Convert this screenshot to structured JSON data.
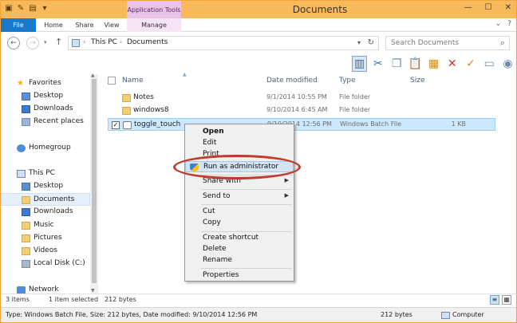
{
  "window": {
    "title": "Documents",
    "context_tab_group": "Application Tools",
    "controls": {
      "minimize": "—",
      "maximize": "☐",
      "close": "✕"
    }
  },
  "ribbon": {
    "tabs": {
      "file": "File",
      "home": "Home",
      "share": "Share",
      "view": "View",
      "manage": "Manage"
    },
    "expand_glyph": "⌄",
    "help_glyph": "?"
  },
  "address": {
    "crumbs": [
      "This PC",
      "Documents"
    ],
    "separator": "›",
    "search_placeholder": "Search Documents"
  },
  "nav": {
    "favorites": "Favorites",
    "desktop": "Desktop",
    "downloads": "Downloads",
    "recent": "Recent places",
    "homegroup": "Homegroup",
    "thispc": "This PC",
    "pc_desktop": "Desktop",
    "pc_documents": "Documents",
    "pc_downloads": "Downloads",
    "pc_music": "Music",
    "pc_pictures": "Pictures",
    "pc_videos": "Videos",
    "pc_disk": "Local Disk (C:)",
    "network": "Network"
  },
  "columns": {
    "name": "Name",
    "date": "Date modified",
    "type": "Type",
    "size": "Size"
  },
  "files": [
    {
      "name": "Notes",
      "date": "9/1/2014 10:55 PM",
      "type": "File folder",
      "size": ""
    },
    {
      "name": "windows8",
      "date": "9/10/2014 6:45 AM",
      "type": "File folder",
      "size": ""
    },
    {
      "name": "toggle_touch",
      "date": "9/10/2014 12:56 PM",
      "type": "Windows Batch File",
      "size": "1 KB"
    }
  ],
  "context_menu": {
    "open": "Open",
    "edit": "Edit",
    "print": "Print",
    "run_admin": "Run as administrator",
    "share_with": "Share with",
    "send_to": "Send to",
    "cut": "Cut",
    "copy": "Copy",
    "create_shortcut": "Create shortcut",
    "delete": "Delete",
    "rename": "Rename",
    "properties": "Properties"
  },
  "status": {
    "items": "3 items",
    "selected": "1 item selected",
    "selected_size": "212 bytes"
  },
  "details": {
    "text": "Type: Windows Batch File, Size: 212 bytes, Date modified: 9/10/2014 12:56 PM",
    "size": "212 bytes",
    "location": "Computer"
  }
}
